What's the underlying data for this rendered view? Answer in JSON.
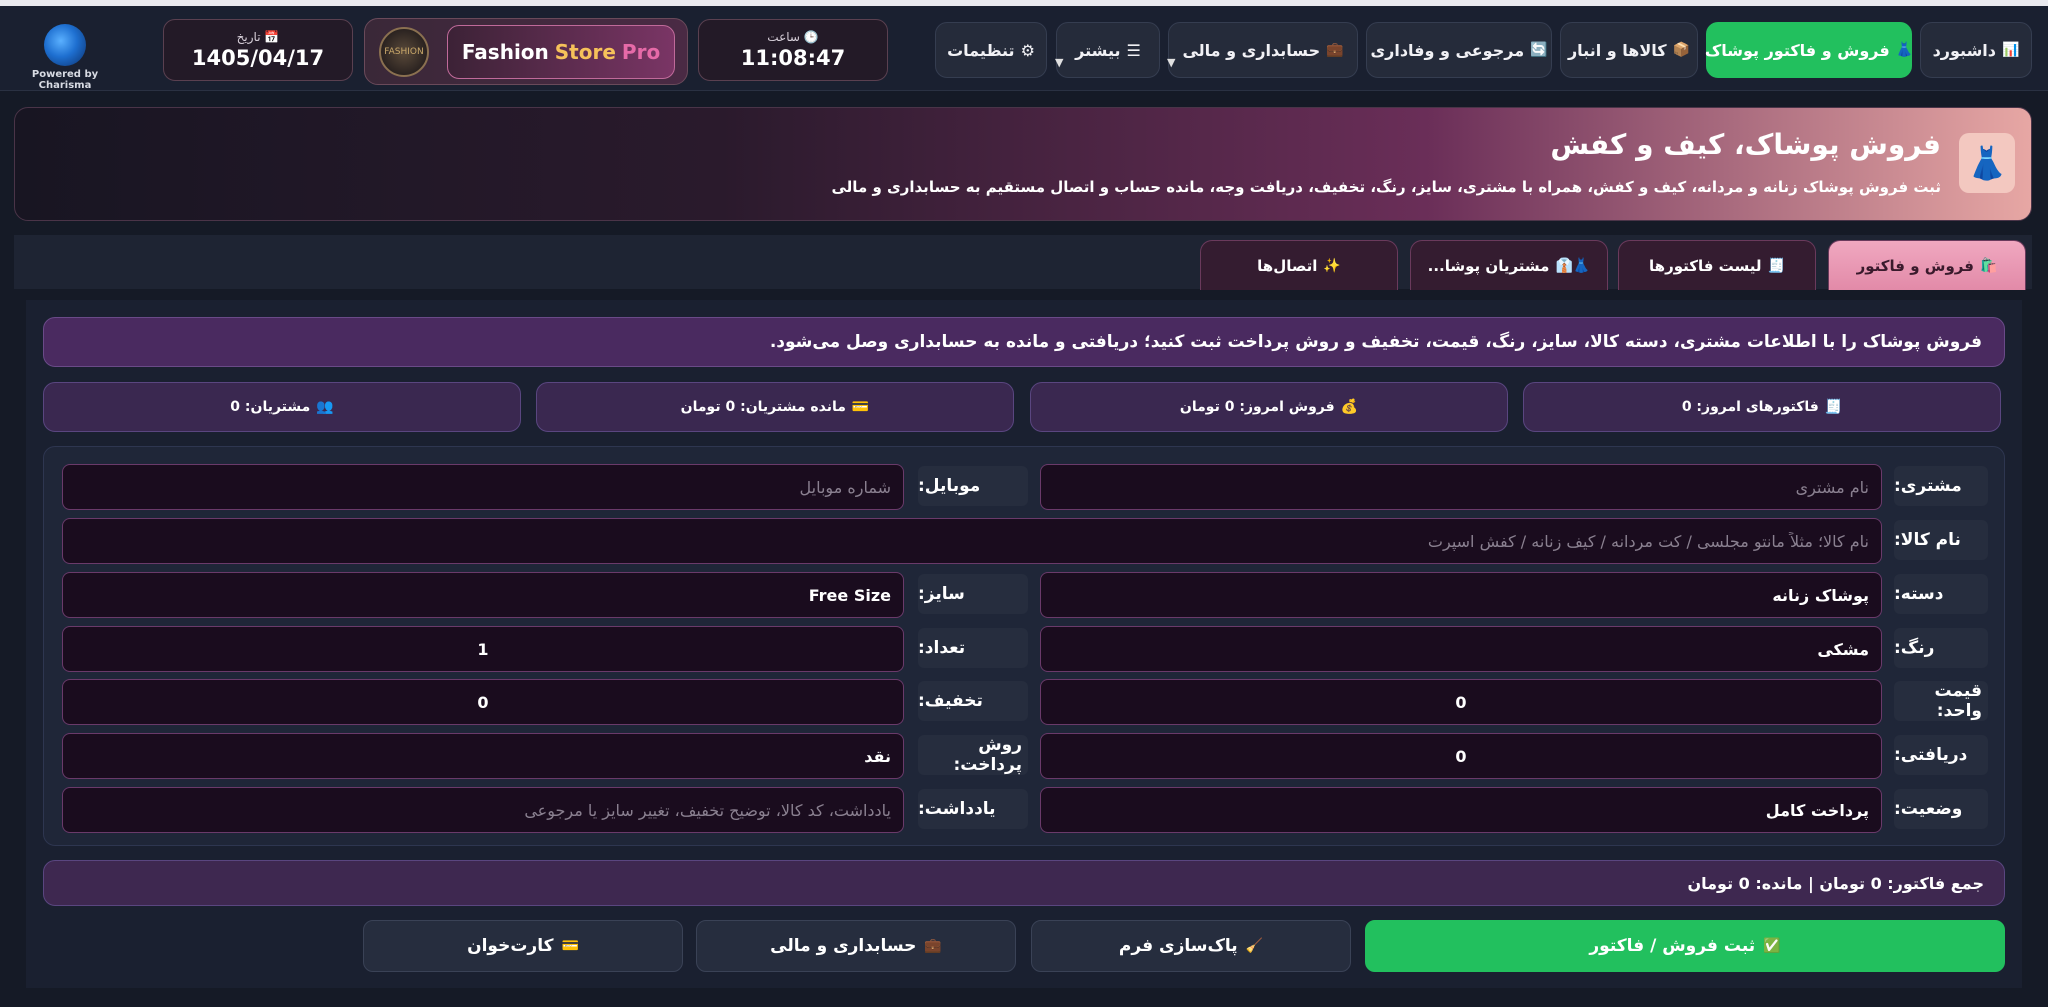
{
  "topbar": {
    "brand": {
      "logo_text": "FASHION",
      "name_1": "Fashion",
      "name_2": "Store",
      "name_3": "Pro"
    },
    "clock": {
      "label": "ساعت",
      "value": "11:08:47",
      "icon": "clock-icon"
    },
    "date": {
      "label": "تاریخ",
      "value": "1405/04/17",
      "icon": "calendar-icon"
    },
    "powered_by": "Powered by Charisma",
    "nav": {
      "dashboard": "داشبورد",
      "sales": "فروش و فاکتور پوشاک",
      "inventory": "کالاها و انبار",
      "returns": "مرجوعی و وفاداری",
      "accounting": "حسابداری و مالی",
      "more": "بیشتر",
      "settings": "تنظیمات"
    }
  },
  "hero": {
    "icon": "dress-icon",
    "title": "فروش پوشاک، کیف و کفش",
    "subtitle": "ثبت فروش پوشاک زنانه و مردانه، کیف و کفش، همراه با مشتری، سایز، رنگ، تخفیف، دریافت وجه، مانده حساب و اتصال مستقیم به حسابداری و مالی"
  },
  "tabs": {
    "sales": "فروش و فاکتور",
    "invoices": "لیست فاکتورها",
    "customers": "مشتریان پوشا...",
    "connections": "اتصال‌ها"
  },
  "notice": "فروش پوشاک را با اطلاعات مشتری، دسته کالا، سایز، رنگ، قیمت، تخفیف و روش پرداخت ثبت کنید؛ دریافتی و مانده به حسابداری وصل می‌شود.",
  "stats": {
    "invoices_today": "فاکتورهای امروز: 0",
    "sales_today": "فروش امروز: 0 تومان",
    "customers_balance": "مانده مشتریان: 0 تومان",
    "customers": "مشتریان: 0"
  },
  "form": {
    "customer_label": "مشتری:",
    "customer_placeholder": "نام مشتری",
    "mobile_label": "موبایل:",
    "mobile_placeholder": "شماره موبایل",
    "product_label": "نام کالا:",
    "product_placeholder": "نام کالا؛ مثلاً مانتو مجلسی / کت مردانه / کیف زنانه / کفش اسپرت",
    "category_label": "دسته:",
    "category_value": "پوشاک زنانه",
    "size_label": "سایز:",
    "size_value": "Free Size",
    "color_label": "رنگ:",
    "color_value": "مشکی",
    "qty_label": "تعداد:",
    "qty_value": "1",
    "unit_price_label": "قیمت واحد:",
    "unit_price_value": "0",
    "discount_label": "تخفیف:",
    "discount_value": "0",
    "received_label": "دریافتی:",
    "received_value": "0",
    "payment_label": "روش پرداخت:",
    "payment_value": "نقد",
    "status_label": "وضعیت:",
    "status_value": "پرداخت کامل",
    "note_label": "یادداشت:",
    "note_placeholder": "یادداشت، کد کالا، توضیح تخفیف، تغییر سایز یا مرجوعی"
  },
  "total": "جمع فاکتور: 0 تومان | مانده: 0 تومان",
  "buttons": {
    "submit": "ثبت فروش / فاکتور",
    "clear": "پاک‌سازی فرم",
    "accounting": "حسابداری و مالی",
    "card_reader": "کارت‌خوان"
  },
  "colors": {
    "accent_green": "#22c05e",
    "accent_purple": "#4a2a60",
    "accent_pink": "#e28aa8"
  }
}
